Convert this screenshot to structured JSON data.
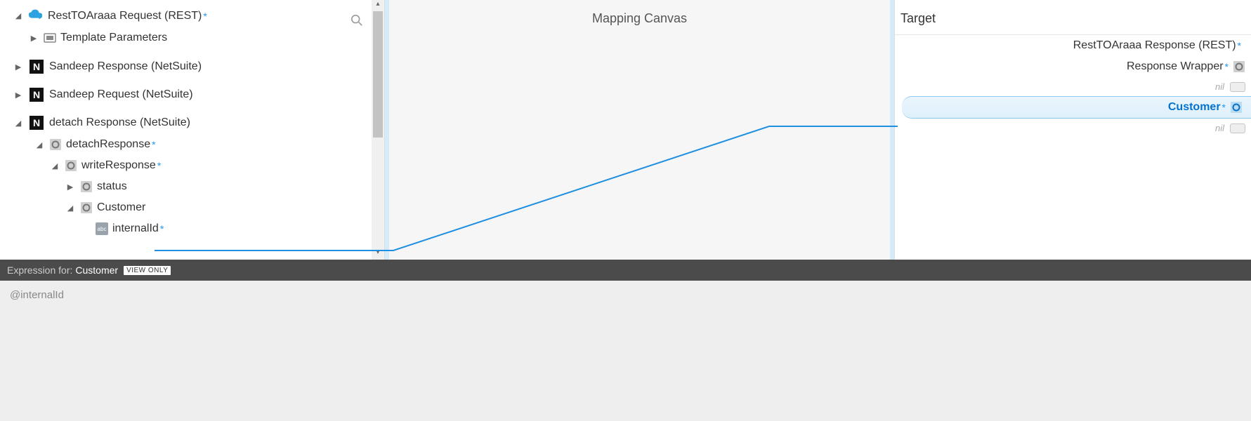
{
  "source": {
    "rest_request": {
      "label": "RestTOAraaa Request (REST)"
    },
    "template_params": {
      "label": "Template Parameters"
    },
    "sandeep_response": {
      "label": "Sandeep Response (NetSuite)"
    },
    "sandeep_request": {
      "label": "Sandeep Request (NetSuite)"
    },
    "detach_response": {
      "label": "detach Response (NetSuite)"
    },
    "detachResponse": {
      "label": "detachResponse"
    },
    "writeResponse": {
      "label": "writeResponse"
    },
    "status": {
      "label": "status"
    },
    "customer": {
      "label": "Customer"
    },
    "internalId": {
      "label": "internalId"
    }
  },
  "canvas": {
    "title": "Mapping Canvas"
  },
  "target": {
    "header": "Target",
    "rest_response": {
      "label": "RestTOAraaa Response (REST)"
    },
    "response_wrapper": {
      "label": "Response Wrapper"
    },
    "nil1": "nil",
    "customer": {
      "label": "Customer"
    },
    "nil2": "nil"
  },
  "expression": {
    "prefix": "Expression for:",
    "field": "Customer",
    "badge": "VIEW ONLY",
    "body": "@internalId"
  }
}
